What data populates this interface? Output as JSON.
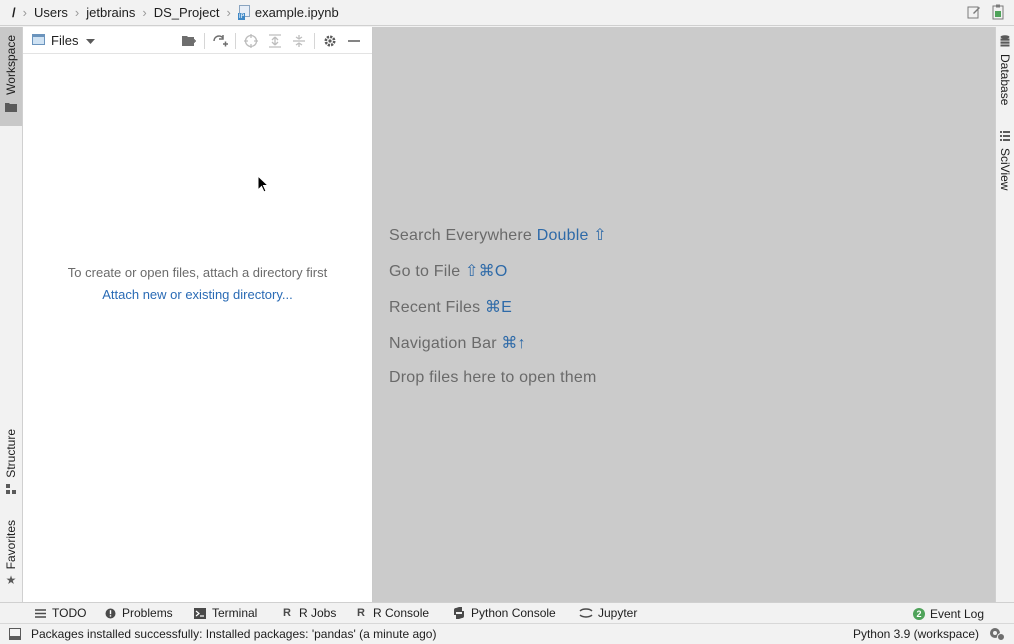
{
  "breadcrumb": {
    "root": "/",
    "items": [
      "Users",
      "jetbrains",
      "DS_Project",
      "example.ipynb"
    ],
    "file_tag": "IP"
  },
  "left_tabs": {
    "workspace": "Workspace",
    "structure": "Structure",
    "favorites": "Favorites"
  },
  "right_tabs": {
    "database": "Database",
    "sciview": "SciView"
  },
  "files_panel": {
    "title": "Files",
    "empty_message": "To create or open files, attach a directory first",
    "attach_link": "Attach new or existing directory..."
  },
  "editor_hints": [
    {
      "text": "Search Everywhere",
      "shortcut": "Double ⇧"
    },
    {
      "text": "Go to File",
      "shortcut": "⇧⌘O"
    },
    {
      "text": "Recent Files",
      "shortcut": "⌘E"
    },
    {
      "text": "Navigation Bar",
      "shortcut": "⌘↑"
    },
    {
      "text": "Drop files here to open them",
      "shortcut": ""
    }
  ],
  "bottom_tabs": [
    {
      "label": "TODO",
      "icon": "list-icon"
    },
    {
      "label": "Problems",
      "icon": "problems-icon"
    },
    {
      "label": "Terminal",
      "icon": "terminal-icon"
    },
    {
      "label": "R Jobs",
      "icon": "r-jobs-icon"
    },
    {
      "label": "R Console",
      "icon": "r-console-icon"
    },
    {
      "label": "Python Console",
      "icon": "python-icon"
    },
    {
      "label": "Jupyter",
      "icon": "jupyter-icon"
    }
  ],
  "event_log": {
    "label": "Event Log",
    "count": "2"
  },
  "status": {
    "message": "Packages installed successfully: Installed packages: 'pandas' (a minute ago)",
    "interpreter": "Python 3.9 (workspace)"
  },
  "colors": {
    "link": "#2a6bb5",
    "shortcut": "#2e6aa8",
    "editor_bg": "#cbcbcb",
    "badge": "#4fa35a"
  }
}
